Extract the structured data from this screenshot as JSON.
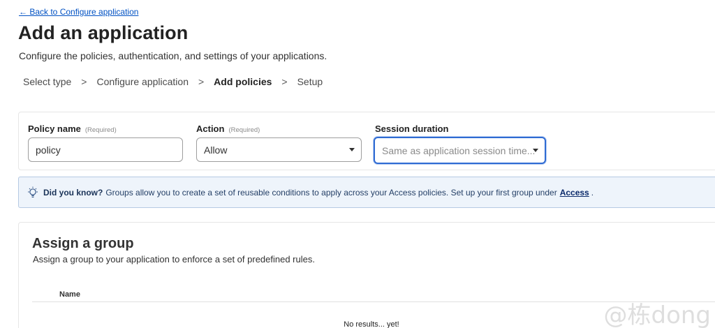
{
  "back_link": "← Back to Configure application",
  "title": "Add an application",
  "description": "Configure the policies, authentication, and settings of your applications.",
  "steps": [
    {
      "label": "Select type",
      "active": false
    },
    {
      "label": "Configure application",
      "active": false
    },
    {
      "label": "Add policies",
      "active": true
    },
    {
      "label": "Setup",
      "active": false
    }
  ],
  "step_separator": ">",
  "policy": {
    "name_label": "Policy name",
    "name_required": "(Required)",
    "name_value": "policy",
    "action_label": "Action",
    "action_required": "(Required)",
    "action_value": "Allow",
    "session_label": "Session duration",
    "session_placeholder": "Same as application session time..."
  },
  "notice": {
    "icon": "lightbulb-icon",
    "lead": "Did you know?",
    "text": "Groups allow you to create a set of reusable conditions to apply across your Access policies. Set up your first group under",
    "link": "Access",
    "tail": "."
  },
  "group": {
    "title": "Assign a group",
    "description": "Assign a group to your application to enforce a set of predefined rules.",
    "column_name": "Name",
    "empty": "No results... yet!"
  },
  "watermark": "@栋dong",
  "colors": {
    "link": "#0051c3",
    "focus": "#2f6bd3",
    "notice_bg": "#eef4fb",
    "notice_border": "#b5c9e3"
  }
}
